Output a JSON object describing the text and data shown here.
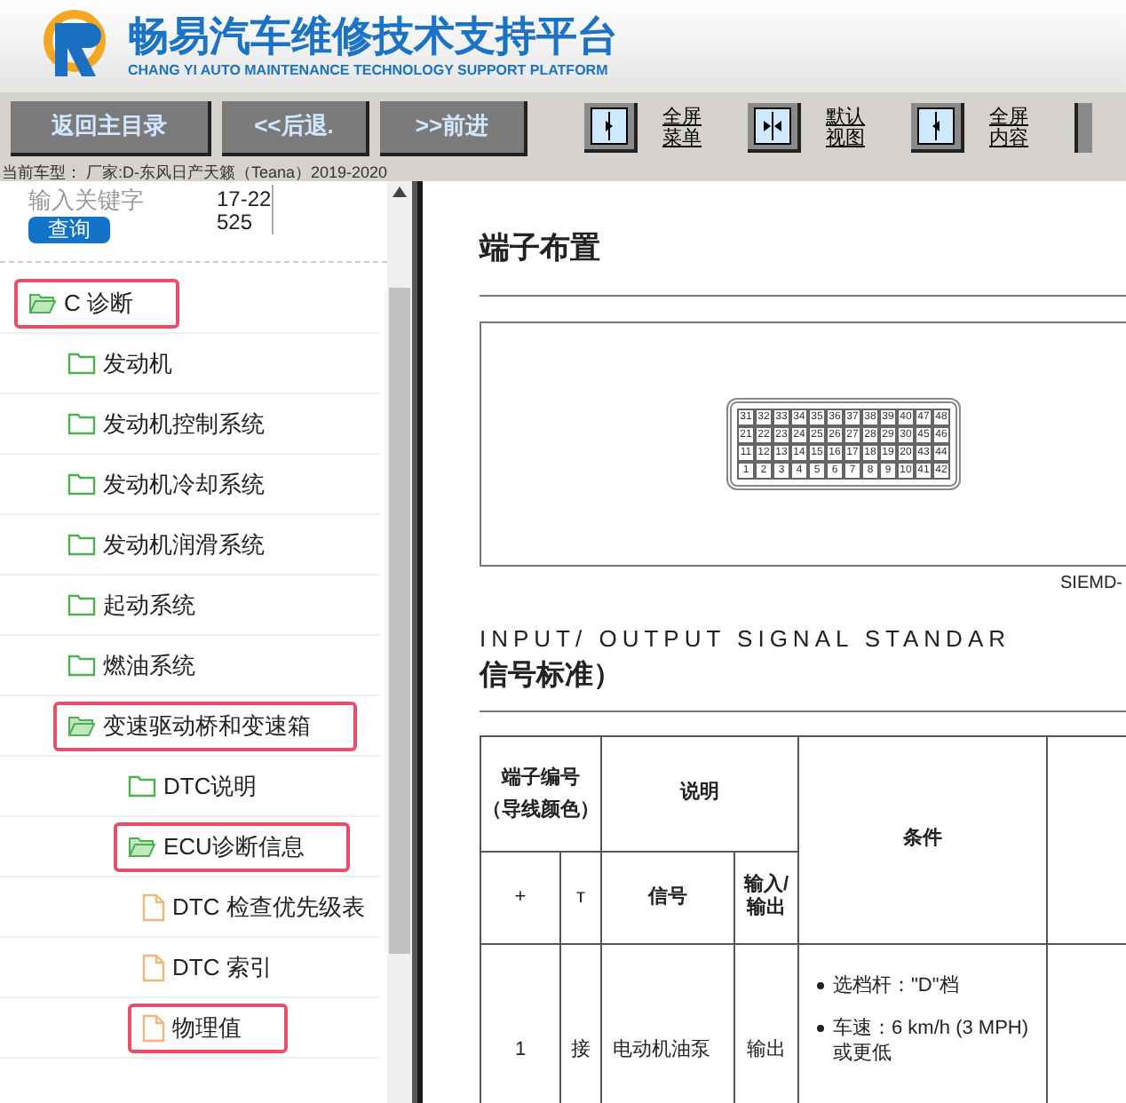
{
  "header": {
    "title": "畅易汽车维修技术支持平台",
    "subtitle": "CHANG YI AUTO MAINTENANCE TECHNOLOGY SUPPORT PLATFORM"
  },
  "toolbar": {
    "nav_buttons": [
      "返回主目录",
      "<<后退.",
      ">>前进"
    ],
    "view_buttons": [
      {
        "kind": "menu",
        "label": "全屏菜单"
      },
      {
        "kind": "default",
        "label": "默认视图"
      },
      {
        "kind": "content",
        "label": "全屏内容"
      }
    ]
  },
  "car_model": "当前车型：  厂家:D-东风日产天籁（Teana）2019-2020",
  "search": {
    "placeholder": "输入关键字",
    "button": "查询",
    "value": "17-22525"
  },
  "tree": [
    {
      "label": "C 诊断",
      "kind": "folder",
      "expanded": true,
      "highlighted": true,
      "children": [
        {
          "label": "发动机",
          "kind": "folder",
          "expanded": false,
          "highlighted": false
        },
        {
          "label": "发动机控制系统",
          "kind": "folder",
          "expanded": false,
          "highlighted": false
        },
        {
          "label": "发动机冷却系统",
          "kind": "folder",
          "expanded": false,
          "highlighted": false
        },
        {
          "label": "发动机润滑系统",
          "kind": "folder",
          "expanded": false,
          "highlighted": false
        },
        {
          "label": "起动系统",
          "kind": "folder",
          "expanded": false,
          "highlighted": false
        },
        {
          "label": "燃油系统",
          "kind": "folder",
          "expanded": false,
          "highlighted": false
        },
        {
          "label": "变速驱动桥和变速箱",
          "kind": "folder",
          "expanded": true,
          "highlighted": true,
          "children": [
            {
              "label": "DTC说明",
              "kind": "folder",
              "expanded": false,
              "highlighted": false
            },
            {
              "label": "ECU诊断信息",
              "kind": "folder",
              "expanded": true,
              "highlighted": true,
              "children": [
                {
                  "label": "DTC 检查优先级表",
                  "kind": "document",
                  "highlighted": false
                },
                {
                  "label": "DTC 索引",
                  "kind": "document",
                  "highlighted": false
                },
                {
                  "label": "物理值",
                  "kind": "document",
                  "highlighted": true
                }
              ]
            }
          ]
        }
      ]
    }
  ],
  "content": {
    "section_title": "端子布置",
    "connector": {
      "rows": [
        [
          "31",
          "32",
          "33",
          "34",
          "35",
          "36",
          "37",
          "38",
          "39",
          "40",
          "47",
          "48"
        ],
        [
          "21",
          "22",
          "23",
          "24",
          "25",
          "26",
          "27",
          "28",
          "29",
          "30",
          "45",
          "46"
        ],
        [
          "11",
          "12",
          "13",
          "14",
          "15",
          "16",
          "17",
          "18",
          "19",
          "20",
          "43",
          "44"
        ],
        [
          "1",
          "2",
          "3",
          "4",
          "5",
          "6",
          "7",
          "8",
          "9",
          "10",
          "41",
          "42"
        ]
      ],
      "caption": "SIEMD-"
    },
    "signal_heading_en": "INPUT/ OUTPUT SIGNAL STANDAR",
    "signal_heading_cn": "信号标准）",
    "table": {
      "header_terminal": "端子编号",
      "header_terminal_note": "（导线颜色）",
      "header_desc": "说明",
      "header_condition": "条件",
      "sub_plus": "+",
      "sub_minus": "ᴛ",
      "sub_signal": "信号",
      "sub_io": "输入/输出",
      "rows": [
        {
          "plus": "1",
          "minus": "接",
          "signal": "电动机油泵",
          "io": "输出",
          "conditions": [
            "选档杆：\"D\"档",
            "车速：6 km/h (3 MPH) 或更低"
          ]
        }
      ]
    }
  }
}
